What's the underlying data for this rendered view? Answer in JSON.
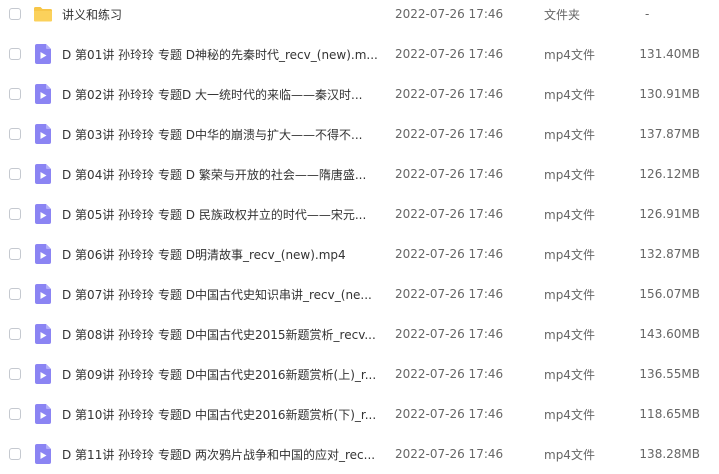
{
  "colors": {
    "folder_icon": "#f7c648",
    "video_icon": "#8b84f3",
    "text_primary": "#333333",
    "text_secondary": "#666666"
  },
  "files": [
    {
      "icon": "folder-icon",
      "name": "讲义和练习",
      "date": "2022-07-26 17:46",
      "type": "文件夹",
      "size": "-"
    },
    {
      "icon": "video-file-icon",
      "name": "D  第01讲 孙玲玲 专题  D神秘的先秦时代_recv_(new).m...",
      "date": "2022-07-26 17:46",
      "type": "mp4文件",
      "size": "131.40MB"
    },
    {
      "icon": "video-file-icon",
      "name": "D  第02讲 孙玲玲 专题D   大一统时代的来临——秦汉时...",
      "date": "2022-07-26 17:46",
      "type": "mp4文件",
      "size": "130.91MB"
    },
    {
      "icon": "video-file-icon",
      "name": "D  第03讲 孙玲玲 专题  D中华的崩溃与扩大——不得不...",
      "date": "2022-07-26 17:46",
      "type": "mp4文件",
      "size": "137.87MB"
    },
    {
      "icon": "video-file-icon",
      "name": "D  第04讲 孙玲玲 专题 D 繁荣与开放的社会——隋唐盛...",
      "date": "2022-07-26 17:46",
      "type": "mp4文件",
      "size": "126.12MB"
    },
    {
      "icon": "video-file-icon",
      "name": "D  第05讲 孙玲玲 专题 D 民族政权并立的时代——宋元...",
      "date": "2022-07-26 17:46",
      "type": "mp4文件",
      "size": "126.91MB"
    },
    {
      "icon": "video-file-icon",
      "name": "D  第06讲 孙玲玲 专题 D明清故事_recv_(new).mp4",
      "date": "2022-07-26 17:46",
      "type": "mp4文件",
      "size": "132.87MB"
    },
    {
      "icon": "video-file-icon",
      "name": "D  第07讲 孙玲玲 专题 D中国古代史知识串讲_recv_(ne...",
      "date": "2022-07-26 17:46",
      "type": "mp4文件",
      "size": "156.07MB"
    },
    {
      "icon": "video-file-icon",
      "name": "D  第08讲 孙玲玲 专题 D中国古代史2015新题赏析_recv...",
      "date": "2022-07-26 17:46",
      "type": "mp4文件",
      "size": "143.60MB"
    },
    {
      "icon": "video-file-icon",
      "name": "D  第09讲 孙玲玲 专题 D中国古代史2016新题赏析(上)_r...",
      "date": "2022-07-26 17:46",
      "type": "mp4文件",
      "size": "136.55MB"
    },
    {
      "icon": "video-file-icon",
      "name": "D  第10讲 孙玲玲 专题D  中国古代史2016新题赏析(下)_r...",
      "date": "2022-07-26 17:46",
      "type": "mp4文件",
      "size": "118.65MB"
    },
    {
      "icon": "video-file-icon",
      "name": "D  第11讲 孙玲玲 专题D 两次鸦片战争和中国的应对_rec...",
      "date": "2022-07-26 17:46",
      "type": "mp4文件",
      "size": "138.28MB"
    }
  ]
}
